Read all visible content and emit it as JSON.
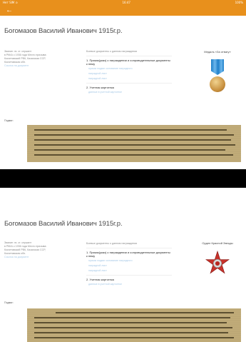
{
  "status_bar": {
    "left": "Нет SIM ⊙",
    "center": "16:47",
    "right": "100%"
  },
  "app_bar": {
    "back_icon": "back-arrow-icon"
  },
  "colors": {
    "accent": "#e8901c",
    "link": "#a5c8e6"
  },
  "records": [
    {
      "title": "Богомазов Василий Иванович 1915г.р.",
      "left_lines": [
        "Звание: гв. ст. сержант",
        "в РККА с 1936 года Место призыва:",
        "Кокчетавский РВК, Казахская ССР,",
        "Кокчетавская обл."
      ],
      "left_link": "Ссылка на документ",
      "mid_heading": "Боевые документы о данном награждении",
      "mid_item1": "1. Приказ(указ) о награждении и сопроводительные документы к нему",
      "mid_links": [
        "приказ подвиг основание наградного",
        "наградной лист",
        "наградной лист"
      ],
      "mid_item2": "2. Учетная картотека",
      "mid_link2": "данные в учетной картотеке",
      "award_title": "Медаль «За отвагу»",
      "award_icon": "medal-icon",
      "doc_label": "Подвиг:"
    },
    {
      "title": "Богомазов Василий Иванович 1915г.р.",
      "left_lines": [
        "Звание: гв. ст. сержант",
        "в РККА с 1936 года Место призыва:",
        "Кокчетавский РВК, Казахская ССР,",
        "Кокчетавская обл."
      ],
      "left_link": "Ссылка на документ",
      "mid_heading": "Боевые документы о данном награждении",
      "mid_item1": "1. Приказ(указ) о награждении и сопроводительные документы к нему",
      "mid_links": [
        "приказ подвиг основание наградного",
        "наградной лист",
        "наградной лист"
      ],
      "mid_item2": "2. Учетная картотека",
      "mid_link2": "данные в учетной картотеке",
      "award_title": "Орден Красной Звезды",
      "award_icon": "red-star-order-icon",
      "doc_label": "Подвиг:"
    }
  ]
}
